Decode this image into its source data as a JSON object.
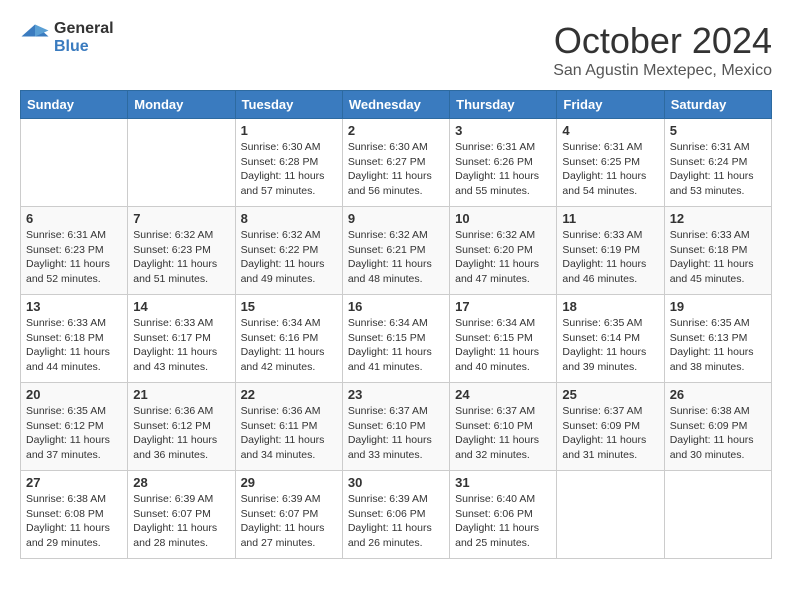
{
  "header": {
    "logo_general": "General",
    "logo_blue": "Blue",
    "month": "October 2024",
    "location": "San Agustin Mextepec, Mexico"
  },
  "weekdays": [
    "Sunday",
    "Monday",
    "Tuesday",
    "Wednesday",
    "Thursday",
    "Friday",
    "Saturday"
  ],
  "weeks": [
    [
      {
        "day": "",
        "info": ""
      },
      {
        "day": "",
        "info": ""
      },
      {
        "day": "1",
        "info": "Sunrise: 6:30 AM\nSunset: 6:28 PM\nDaylight: 11 hours and 57 minutes."
      },
      {
        "day": "2",
        "info": "Sunrise: 6:30 AM\nSunset: 6:27 PM\nDaylight: 11 hours and 56 minutes."
      },
      {
        "day": "3",
        "info": "Sunrise: 6:31 AM\nSunset: 6:26 PM\nDaylight: 11 hours and 55 minutes."
      },
      {
        "day": "4",
        "info": "Sunrise: 6:31 AM\nSunset: 6:25 PM\nDaylight: 11 hours and 54 minutes."
      },
      {
        "day": "5",
        "info": "Sunrise: 6:31 AM\nSunset: 6:24 PM\nDaylight: 11 hours and 53 minutes."
      }
    ],
    [
      {
        "day": "6",
        "info": "Sunrise: 6:31 AM\nSunset: 6:23 PM\nDaylight: 11 hours and 52 minutes."
      },
      {
        "day": "7",
        "info": "Sunrise: 6:32 AM\nSunset: 6:23 PM\nDaylight: 11 hours and 51 minutes."
      },
      {
        "day": "8",
        "info": "Sunrise: 6:32 AM\nSunset: 6:22 PM\nDaylight: 11 hours and 49 minutes."
      },
      {
        "day": "9",
        "info": "Sunrise: 6:32 AM\nSunset: 6:21 PM\nDaylight: 11 hours and 48 minutes."
      },
      {
        "day": "10",
        "info": "Sunrise: 6:32 AM\nSunset: 6:20 PM\nDaylight: 11 hours and 47 minutes."
      },
      {
        "day": "11",
        "info": "Sunrise: 6:33 AM\nSunset: 6:19 PM\nDaylight: 11 hours and 46 minutes."
      },
      {
        "day": "12",
        "info": "Sunrise: 6:33 AM\nSunset: 6:18 PM\nDaylight: 11 hours and 45 minutes."
      }
    ],
    [
      {
        "day": "13",
        "info": "Sunrise: 6:33 AM\nSunset: 6:18 PM\nDaylight: 11 hours and 44 minutes."
      },
      {
        "day": "14",
        "info": "Sunrise: 6:33 AM\nSunset: 6:17 PM\nDaylight: 11 hours and 43 minutes."
      },
      {
        "day": "15",
        "info": "Sunrise: 6:34 AM\nSunset: 6:16 PM\nDaylight: 11 hours and 42 minutes."
      },
      {
        "day": "16",
        "info": "Sunrise: 6:34 AM\nSunset: 6:15 PM\nDaylight: 11 hours and 41 minutes."
      },
      {
        "day": "17",
        "info": "Sunrise: 6:34 AM\nSunset: 6:15 PM\nDaylight: 11 hours and 40 minutes."
      },
      {
        "day": "18",
        "info": "Sunrise: 6:35 AM\nSunset: 6:14 PM\nDaylight: 11 hours and 39 minutes."
      },
      {
        "day": "19",
        "info": "Sunrise: 6:35 AM\nSunset: 6:13 PM\nDaylight: 11 hours and 38 minutes."
      }
    ],
    [
      {
        "day": "20",
        "info": "Sunrise: 6:35 AM\nSunset: 6:12 PM\nDaylight: 11 hours and 37 minutes."
      },
      {
        "day": "21",
        "info": "Sunrise: 6:36 AM\nSunset: 6:12 PM\nDaylight: 11 hours and 36 minutes."
      },
      {
        "day": "22",
        "info": "Sunrise: 6:36 AM\nSunset: 6:11 PM\nDaylight: 11 hours and 34 minutes."
      },
      {
        "day": "23",
        "info": "Sunrise: 6:37 AM\nSunset: 6:10 PM\nDaylight: 11 hours and 33 minutes."
      },
      {
        "day": "24",
        "info": "Sunrise: 6:37 AM\nSunset: 6:10 PM\nDaylight: 11 hours and 32 minutes."
      },
      {
        "day": "25",
        "info": "Sunrise: 6:37 AM\nSunset: 6:09 PM\nDaylight: 11 hours and 31 minutes."
      },
      {
        "day": "26",
        "info": "Sunrise: 6:38 AM\nSunset: 6:09 PM\nDaylight: 11 hours and 30 minutes."
      }
    ],
    [
      {
        "day": "27",
        "info": "Sunrise: 6:38 AM\nSunset: 6:08 PM\nDaylight: 11 hours and 29 minutes."
      },
      {
        "day": "28",
        "info": "Sunrise: 6:39 AM\nSunset: 6:07 PM\nDaylight: 11 hours and 28 minutes."
      },
      {
        "day": "29",
        "info": "Sunrise: 6:39 AM\nSunset: 6:07 PM\nDaylight: 11 hours and 27 minutes."
      },
      {
        "day": "30",
        "info": "Sunrise: 6:39 AM\nSunset: 6:06 PM\nDaylight: 11 hours and 26 minutes."
      },
      {
        "day": "31",
        "info": "Sunrise: 6:40 AM\nSunset: 6:06 PM\nDaylight: 11 hours and 25 minutes."
      },
      {
        "day": "",
        "info": ""
      },
      {
        "day": "",
        "info": ""
      }
    ]
  ]
}
